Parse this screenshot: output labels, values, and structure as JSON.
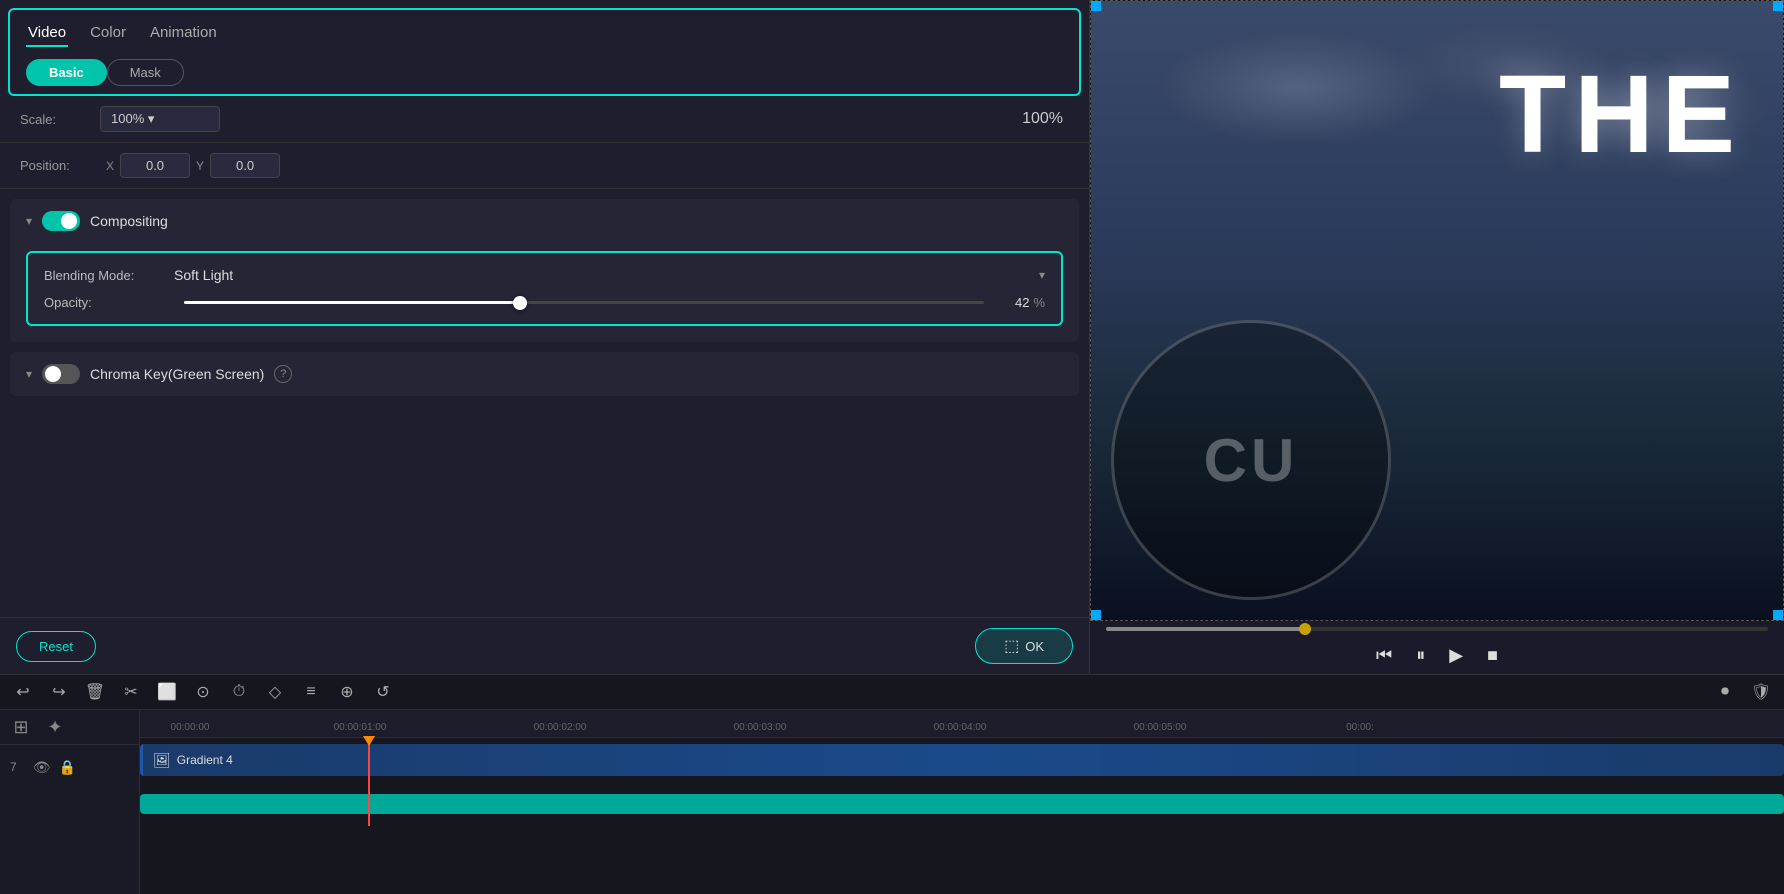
{
  "tabs": {
    "items": [
      {
        "label": "Video",
        "active": true
      },
      {
        "label": "Color",
        "active": false
      },
      {
        "label": "Animation",
        "active": false
      }
    ],
    "subtabs": [
      {
        "label": "Basic",
        "active": true
      },
      {
        "label": "Mask",
        "active": false
      }
    ]
  },
  "scale_row": {
    "label": "Scale:",
    "dropdown_value": "100%",
    "position_label": "Position:",
    "x_label": "X",
    "x_value": "0.0",
    "y_label": "Y",
    "y_value": "0.0"
  },
  "compositing": {
    "title": "Compositing",
    "blending": {
      "label": "Blending Mode:",
      "value": "Soft Light"
    },
    "opacity": {
      "label": "Opacity:",
      "value": "42",
      "unit": "%",
      "slider_percent": 42
    }
  },
  "chroma_key": {
    "title": "Chroma Key(Green Screen)"
  },
  "bottom": {
    "reset_label": "Reset",
    "ok_label": "OK"
  },
  "toolbar": {
    "icons": [
      "↩",
      "↪",
      "🗑",
      "✂",
      "⬜",
      "⊙",
      "⏱",
      "◇",
      "≡",
      "⊕",
      "↺"
    ]
  },
  "timeline": {
    "times": [
      "00:00:00",
      "00:00:01:00",
      "00:00:02:00",
      "00:00:03:00",
      "00:00:04:00",
      "00:00:05:00",
      "00:00:"
    ],
    "track_num": "7",
    "clip_name": "Gradient 4"
  },
  "preview": {
    "text": "THE"
  }
}
